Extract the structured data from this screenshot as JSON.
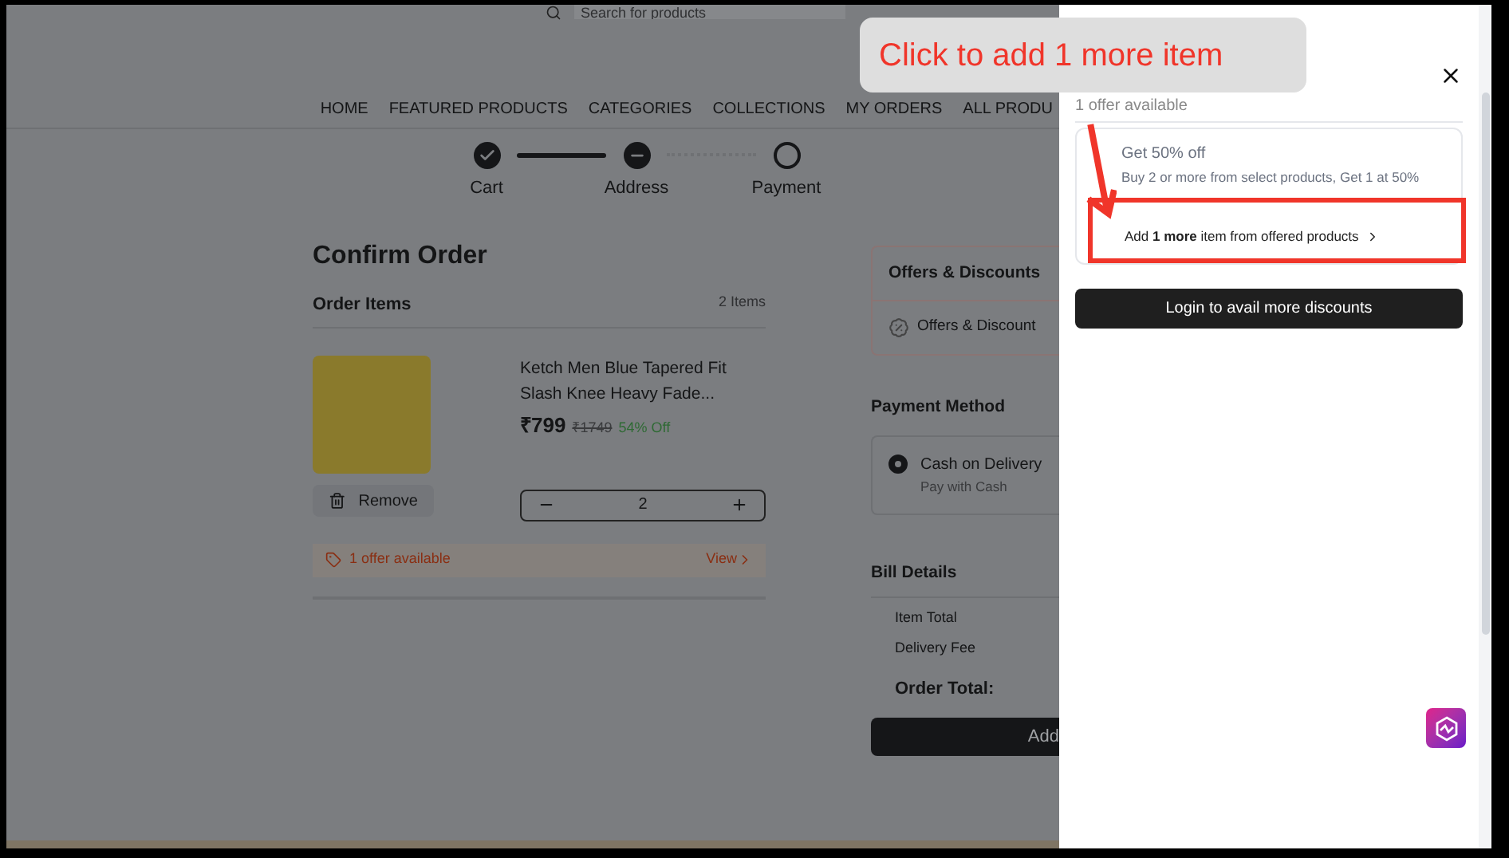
{
  "search": {
    "placeholder": "Search for products"
  },
  "nav": [
    "HOME",
    "FEATURED PRODUCTS",
    "CATEGORIES",
    "COLLECTIONS",
    "MY ORDERS",
    "ALL PRODU"
  ],
  "steps": [
    {
      "label": "Cart",
      "done": true,
      "current": false
    },
    {
      "label": "Address",
      "done": false,
      "current": true
    },
    {
      "label": "Payment",
      "done": false,
      "current": false
    }
  ],
  "page_title": "Confirm Order",
  "order_items": {
    "title": "Order Items",
    "count": "2 Items",
    "item": {
      "name": "Ketch Men Blue Tapered Fit Slash Knee Heavy Fade...",
      "price": "₹799",
      "mrp": "₹1749",
      "discount": "54% Off",
      "remove": "Remove",
      "quantity": "2",
      "offer": "1 offer available",
      "view": "View"
    }
  },
  "offers_panel": {
    "title": "Offers & Discounts",
    "row": "Offers & Discount"
  },
  "payment": {
    "title": "Payment Method",
    "options": [
      {
        "label": "Cash on Delivery",
        "sub": "Pay with Cash",
        "selected": true
      }
    ]
  },
  "bill": {
    "title": "Bill Details",
    "rows": [
      "Item Total",
      "Delivery Fee"
    ],
    "total": "Order Total:",
    "button": "Add"
  },
  "drawer": {
    "heading": "1 offer available",
    "offer_title": "Get 50% off",
    "offer_desc": "Buy 2 or more from select products, Get 1 at 50%",
    "add_link": "Add **1 more** item from offered products",
    "login": "Login to avail more discounts"
  },
  "callout": "Click to add 1 more item"
}
